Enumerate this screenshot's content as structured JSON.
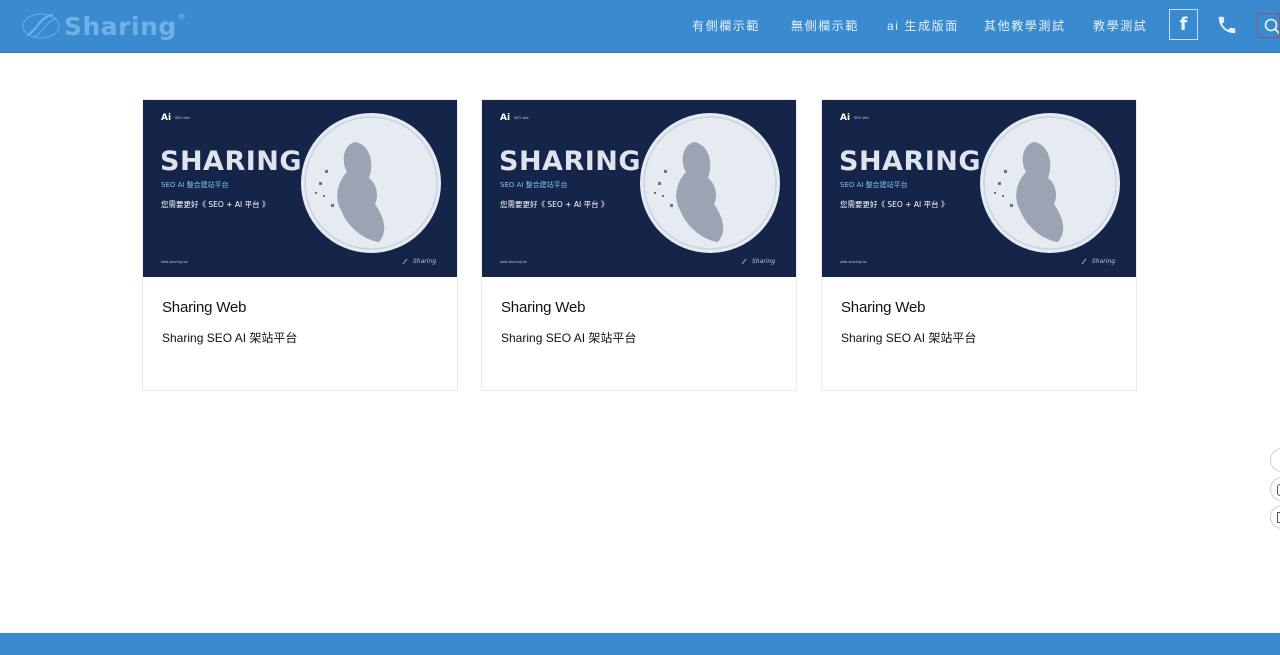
{
  "header": {
    "logo_text": "Sharing",
    "logo_reg": "®",
    "nav": [
      {
        "label": "有側欄示範"
      },
      {
        "label": "無側欄示範"
      },
      {
        "label": "ai 生成版面"
      },
      {
        "label": "其他教學測試"
      },
      {
        "label": "教學測試"
      }
    ],
    "facebook_glyph": "f"
  },
  "cards": [
    {
      "title": "Sharing Web",
      "description": "Sharing SEO AI 架站平台",
      "banner": {
        "badge": "Ai",
        "badge_small": "SEO site",
        "headline": "SHARING",
        "subline": "SEO AI 整合建站平台",
        "tagline": "您需要更好《 SEO + AI 平台 》",
        "url": "web.sharing.tw",
        "brand": "Sharing"
      }
    },
    {
      "title": "Sharing Web",
      "description": "Sharing SEO AI 架站平台",
      "banner": {
        "badge": "Ai",
        "badge_small": "SEO site",
        "headline": "SHARING",
        "subline": "SEO AI 整合建站平台",
        "tagline": "您需要更好《 SEO + AI 平台 》",
        "url": "web.sharing.tw",
        "brand": "Sharing"
      }
    },
    {
      "title": "Sharing Web",
      "description": "Sharing SEO AI 架站平台",
      "banner": {
        "badge": "Ai",
        "badge_small": "SEO site",
        "headline": "SHARING",
        "subline": "SEO AI 整合建站平台",
        "tagline": "您需要更好《 SEO + AI 平台 》",
        "url": "web.sharing.tw",
        "brand": "Sharing"
      }
    }
  ],
  "colors": {
    "header_bg": "#3a8ad0",
    "banner_bg": "#15254a",
    "accent": "#6fb0e6"
  },
  "icons": {
    "logo": "sharing-swirl-logo",
    "facebook": "facebook-icon",
    "phone": "phone-icon",
    "search": "search-icon",
    "side_buttons": [
      "side-button-icon",
      "side-button-icon",
      "side-button-icon"
    ]
  }
}
